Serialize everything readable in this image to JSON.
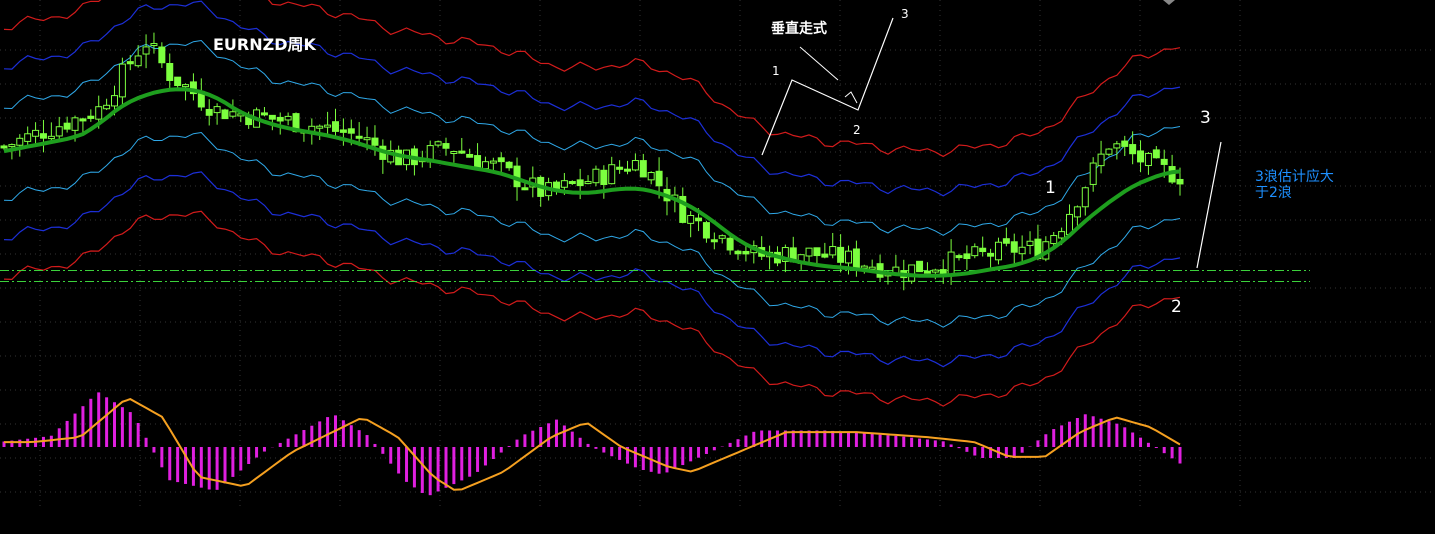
{
  "texts": {
    "title": "EURNZD周K",
    "vertical_pattern": "垂直走式",
    "sketch_wave_1": "1",
    "sketch_wave_2": "2",
    "sketch_wave_3": "3",
    "wave_1": "1",
    "wave_2": "2",
    "wave_3": "3",
    "note_line1": "3浪估计应大",
    "note_line2": "于2浪"
  },
  "colors": {
    "background": "#000000",
    "candle": "#7CFF3F",
    "ma_thick": "#1E9E1E",
    "band_inner": "#2FA8E8",
    "band_mid": "#1C2FD8",
    "band_outer": "#D21B1B",
    "support_line": "#3BD13B",
    "histogram": "#E020E0",
    "signal_line": "#F5A020",
    "annotation": "#FFFFFF",
    "note": "#1E90FF"
  },
  "chart_data": {
    "type": "candlestick",
    "symbol": "EURNZD",
    "timeframe": "weekly",
    "axes_labels_visible": false,
    "grid": "dotted",
    "price_path": [
      [
        0,
        0.64
      ],
      [
        8,
        0.74
      ],
      [
        12,
        0.93
      ],
      [
        14,
        0.84
      ],
      [
        18,
        0.74
      ],
      [
        22,
        0.72
      ],
      [
        26,
        0.7
      ],
      [
        30,
        0.67
      ],
      [
        34,
        0.6
      ],
      [
        38,
        0.64
      ],
      [
        42,
        0.58
      ],
      [
        46,
        0.51
      ],
      [
        50,
        0.55
      ],
      [
        54,
        0.6
      ],
      [
        58,
        0.45
      ],
      [
        64,
        0.34
      ],
      [
        68,
        0.35
      ],
      [
        72,
        0.33
      ],
      [
        76,
        0.3
      ],
      [
        80,
        0.32
      ],
      [
        86,
        0.36
      ],
      [
        88,
        0.36
      ],
      [
        90,
        0.43
      ],
      [
        94,
        0.65
      ],
      [
        98,
        0.58
      ],
      [
        100,
        0.56
      ]
    ],
    "histogram_path": [
      [
        0,
        0.1
      ],
      [
        4,
        0.2
      ],
      [
        8,
        1.0
      ],
      [
        11,
        0.6
      ],
      [
        14,
        -0.6
      ],
      [
        18,
        -0.8
      ],
      [
        22,
        -0.1
      ],
      [
        28,
        0.6
      ],
      [
        31,
        0.2
      ],
      [
        34,
        -0.6
      ],
      [
        36,
        -0.9
      ],
      [
        40,
        -0.5
      ],
      [
        44,
        0.2
      ],
      [
        47,
        0.5
      ],
      [
        50,
        0.0
      ],
      [
        54,
        -0.4
      ],
      [
        56,
        -0.5
      ],
      [
        60,
        -0.1
      ],
      [
        64,
        0.3
      ],
      [
        70,
        0.3
      ],
      [
        76,
        0.2
      ],
      [
        80,
        0.1
      ],
      [
        83,
        -0.2
      ],
      [
        86,
        -0.2
      ],
      [
        89,
        0.3
      ],
      [
        92,
        0.6
      ],
      [
        95,
        0.4
      ],
      [
        100,
        -0.3
      ]
    ],
    "support_levels": [
      0.3,
      0.27
    ]
  }
}
